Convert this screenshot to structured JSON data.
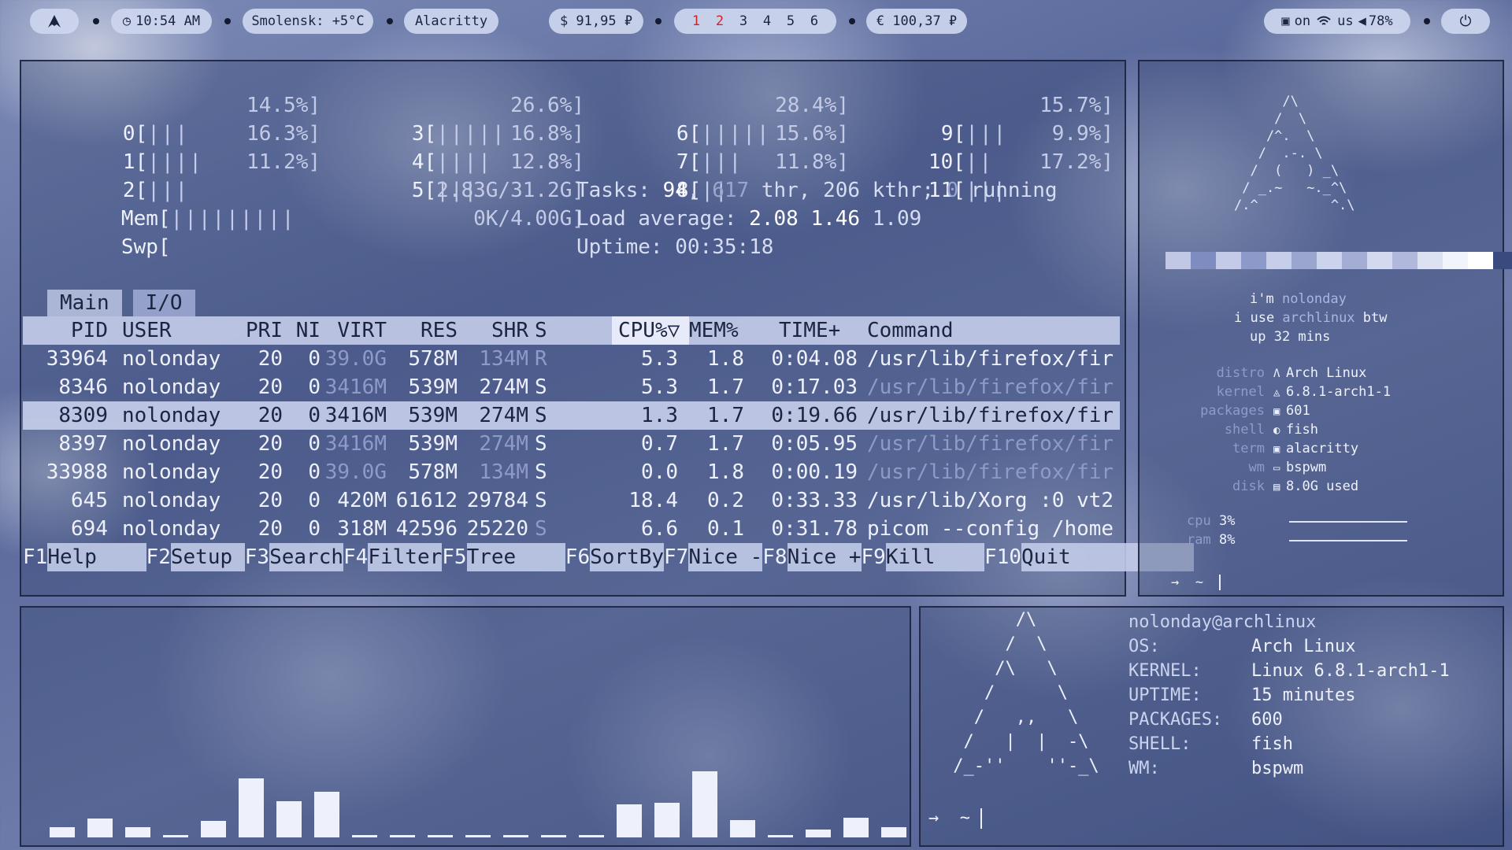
{
  "topbar": {
    "arch_icon": "arch-logo-icon",
    "clock": "10:54 AM",
    "weather": "Smolensk: +5°C",
    "window_title": "Alacritty",
    "usd": "$ 91,95 ₽",
    "eur": "€ 100,37 ₽",
    "workspaces": [
      "1",
      "2",
      "3",
      "4",
      "5",
      "6"
    ],
    "net_state": "on",
    "layout": "us",
    "volume": "78%",
    "colors": {
      "pill": "#cdd6ee",
      "active_workspace": "#d0222a"
    }
  },
  "htop": {
    "cpus": [
      {
        "label": "0[",
        "bar": "|||",
        "pct": "14.5%]"
      },
      {
        "label": "1[",
        "bar": "||||",
        "pct": "16.3%]"
      },
      {
        "label": "2[",
        "bar": "|||",
        "pct": "11.2%]"
      },
      {
        "label": "3[",
        "bar": "|||||",
        "pct": "26.6%]"
      },
      {
        "label": "4[",
        "bar": "||||",
        "pct": "16.8%]"
      },
      {
        "label": "5[",
        "bar": "|||",
        "pct": "12.8%]"
      },
      {
        "label": "6[",
        "bar": "|||||",
        "pct": "28.4%]"
      },
      {
        "label": "7[",
        "bar": "|||",
        "pct": "15.6%]"
      },
      {
        "label": "8[",
        "bar": "||",
        "pct": "11.8%]"
      },
      {
        "label": "9[",
        "bar": "|||",
        "pct": "15.7%]"
      },
      {
        "label": "10[",
        "bar": "||",
        "pct": "9.9%]"
      },
      {
        "label": "11[",
        "bar": "|||",
        "pct": "17.2%]"
      }
    ],
    "mem": {
      "label": "Mem[",
      "bar": "|||||||||",
      "value": "2.83G/31.2G]"
    },
    "swp": {
      "label": "Swp[",
      "bar": "",
      "value": "0K/4.00G]"
    },
    "tasks": {
      "prefix": "Tasks: ",
      "tasks": "94",
      "sep": ", ",
      "thr": "617",
      "rest": " thr, 206 kthr; ",
      "running": "0",
      "suffix": " running"
    },
    "load": {
      "prefix": "Load average: ",
      "l1": "2.08",
      "l5": "1.46",
      "l15": "1.09"
    },
    "uptime": {
      "prefix": "Uptime: ",
      "value": "00:35:18"
    },
    "tabs": [
      "Main",
      "I/O"
    ],
    "columns": [
      "PID",
      "USER",
      "PRI",
      "NI",
      "VIRT",
      "RES",
      "SHR",
      "S",
      "CPU%▽",
      "MEM%",
      "TIME+",
      "Command"
    ],
    "rows": [
      {
        "pid": "33964",
        "user": "nolonday",
        "pri": "20",
        "ni": "0",
        "virt": "39.0G",
        "res": "578M",
        "shr": "134M",
        "s": "R",
        "cpu": "5.3",
        "mem": "1.8",
        "time": "0:04.08",
        "cmd": "/usr/lib/firefox/fir"
      },
      {
        "pid": "8346",
        "user": "nolonday",
        "pri": "20",
        "ni": "0",
        "virt": "3416M",
        "res": "539M",
        "shr": "274M",
        "s": "S",
        "cpu": "5.3",
        "mem": "1.7",
        "time": "0:17.03",
        "cmd": "/usr/lib/firefox/fir"
      },
      {
        "pid": "8309",
        "user": "nolonday",
        "pri": "20",
        "ni": "0",
        "virt": "3416M",
        "res": "539M",
        "shr": "274M",
        "s": "S",
        "cpu": "1.3",
        "mem": "1.7",
        "time": "0:19.66",
        "cmd": "/usr/lib/firefox/fir"
      },
      {
        "pid": "8397",
        "user": "nolonday",
        "pri": "20",
        "ni": "0",
        "virt": "3416M",
        "res": "539M",
        "shr": "274M",
        "s": "S",
        "cpu": "0.7",
        "mem": "1.7",
        "time": "0:05.95",
        "cmd": "/usr/lib/firefox/fir"
      },
      {
        "pid": "33988",
        "user": "nolonday",
        "pri": "20",
        "ni": "0",
        "virt": "39.0G",
        "res": "578M",
        "shr": "134M",
        "s": "S",
        "cpu": "0.0",
        "mem": "1.8",
        "time": "0:00.19",
        "cmd": "/usr/lib/firefox/fir"
      },
      {
        "pid": "645",
        "user": "nolonday",
        "pri": "20",
        "ni": "0",
        "virt": "420M",
        "res": "61612",
        "shr": "29784",
        "s": "S",
        "cpu": "18.4",
        "mem": "0.2",
        "time": "0:33.33",
        "cmd": "/usr/lib/Xorg :0 vt2"
      },
      {
        "pid": "694",
        "user": "nolonday",
        "pri": "20",
        "ni": "0",
        "virt": "318M",
        "res": "42596",
        "shr": "25220",
        "s": "S",
        "cpu": "6.6",
        "mem": "0.1",
        "time": "0:31.78",
        "cmd": "picom --config /home"
      }
    ],
    "fkeys": [
      {
        "key": "F1",
        "label": "Help    "
      },
      {
        "key": "F2",
        "label": "Setup "
      },
      {
        "key": "F3",
        "label": "Search"
      },
      {
        "key": "F4",
        "label": "Filter"
      },
      {
        "key": "F5",
        "label": "Tree    "
      },
      {
        "key": "F6",
        "label": "SortBy"
      },
      {
        "key": "F7",
        "label": "Nice -"
      },
      {
        "key": "F8",
        "label": "Nice +"
      },
      {
        "key": "F9",
        "label": "Kill    "
      },
      {
        "key": "F10",
        "label": "Quit          "
      }
    ]
  },
  "side": {
    "ascii": "      /\\\n     /  \\\n    /^.  \\\n   /  .-. \\\n  /  (   ) _\\\n / _.~   ~._^\\\n/.^         ^.\\",
    "line1_prefix": "i'm ",
    "line1_name": "nolonday",
    "line2_prefix": "i use ",
    "line2_distro": "archlinux",
    "line2_suffix": " btw",
    "line3": "up 32 mins",
    "info": [
      {
        "key": "distro",
        "icon": "Λ",
        "icon_name": "arch-icon",
        "value": "Arch Linux"
      },
      {
        "key": "kernel",
        "icon": "🐧",
        "icon_name": "tux-icon",
        "value": "6.8.1-arch1-1"
      },
      {
        "key": "packages",
        "icon": "▣",
        "icon_name": "package-icon",
        "value": "601"
      },
      {
        "key": "shell",
        "icon": "◐",
        "icon_name": "shell-icon",
        "value": "fish"
      },
      {
        "key": "term",
        "icon": "▣",
        "icon_name": "terminal-icon",
        "value": "alacritty"
      },
      {
        "key": "wm",
        "icon": "▭",
        "icon_name": "window-icon",
        "value": "bspwm"
      },
      {
        "key": "disk",
        "icon": "▤",
        "icon_name": "disk-icon",
        "value": "8.0G used"
      }
    ],
    "cpu": {
      "label": "cpu",
      "value": "3%"
    },
    "ram": {
      "label": "ram",
      "value": "8%"
    },
    "return_glyph": "-⏎",
    "prompt": "→  ~  "
  },
  "cava": {
    "levels": [
      0.12,
      0.22,
      0.12,
      0.03,
      0.19,
      0.68,
      0.42,
      0.53,
      0.03,
      0.03,
      0.03,
      0.03,
      0.03,
      0.03,
      0.03,
      0.38,
      0.4,
      0.76,
      0.2,
      0.03,
      0.09,
      0.23,
      0.12
    ]
  },
  "fetch": {
    "ascii": "       /\\\n      /  \\\n     /\\   \\\n    /      \\\n   /   ,,   \\\n  /   |  |  -\\\n /_-''    ''-_\\",
    "user_host": "nolonday@archlinux",
    "rows": [
      {
        "key": "OS:",
        "value": "Arch Linux"
      },
      {
        "key": "KERNEL:",
        "value": "Linux 6.8.1-arch1-1"
      },
      {
        "key": "UPTIME:",
        "value": "15 minutes"
      },
      {
        "key": "PACKAGES:",
        "value": "600"
      },
      {
        "key": "SHELL:",
        "value": "fish"
      },
      {
        "key": "WM:",
        "value": "bspwm"
      }
    ],
    "prompt": "→  ~ "
  }
}
